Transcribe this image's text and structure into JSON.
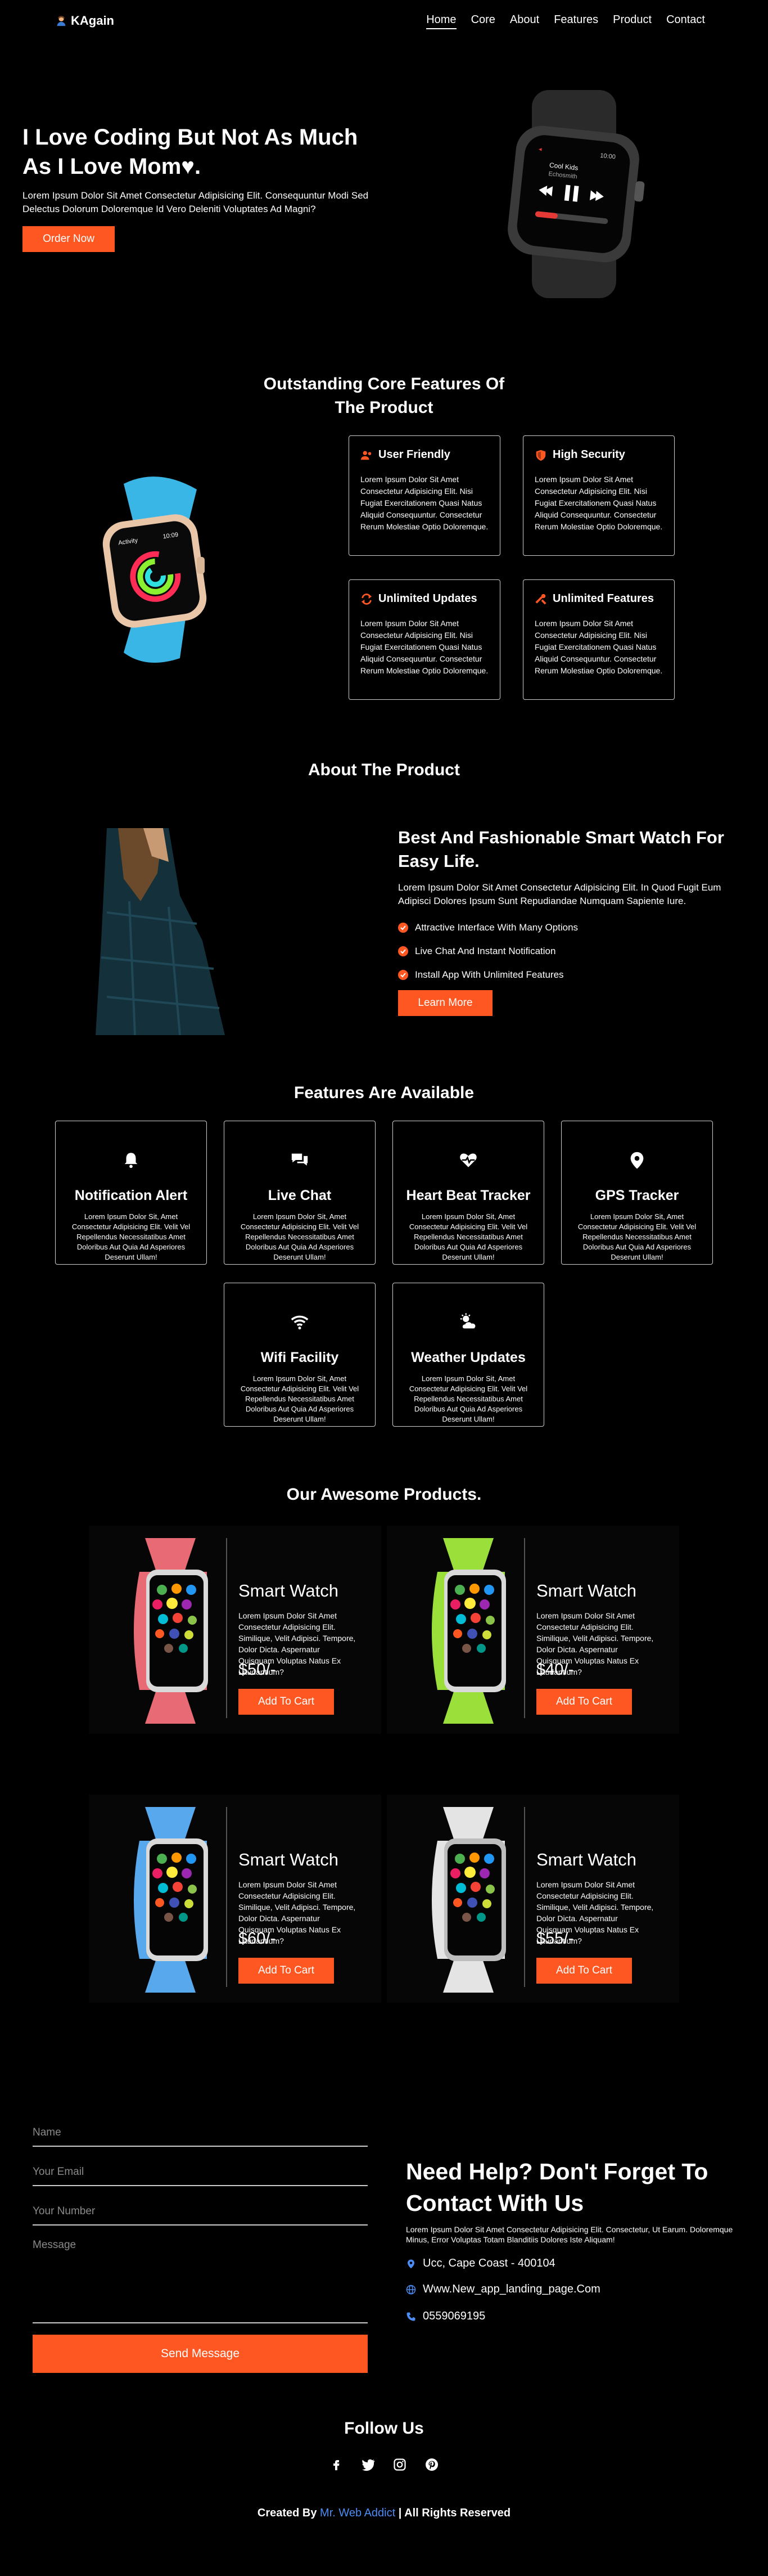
{
  "colors": {
    "accent": "#ff5722",
    "background": "#000000",
    "link": "#4c8cf5"
  },
  "nav": {
    "brand": "KAgain",
    "brand_icon": "person-icon",
    "links": [
      "Home",
      "Core",
      "About",
      "Features",
      "Product",
      "Contact"
    ],
    "active": "Home"
  },
  "hero": {
    "title_line1": "I Love Coding But Not As Much",
    "title_line2": "As I Love Mom",
    "heart": "♥",
    "period": ".",
    "subtitle": "Lorem Ipsum Dolor Sit Amet Consectetur Adipisicing Elit. Consequuntur Modi Sed Delectus Dolorum Doloremque Id Vero Deleniti Voluptates Ad Magni?",
    "button": "Order Now",
    "watch_screen": {
      "time": "10:00",
      "title": "Cool Kids",
      "artist": "Echosmith"
    }
  },
  "core": {
    "title_line1": "Outstanding Core Features Of",
    "title_line2": "The Product",
    "watch_screen": {
      "label": "Activity",
      "time": "10:09"
    },
    "cards": [
      {
        "title": "User Friendly",
        "icon": "users-icon",
        "text": "Lorem Ipsum Dolor Sit Amet Consectetur Adipisicing Elit. Nisi Fugiat Exercitationem Quasi Natus Aliquid Consequuntur. Consectetur Rerum Molestiae Optio Doloremque."
      },
      {
        "title": "High Security",
        "icon": "shield-icon",
        "text": "Lorem Ipsum Dolor Sit Amet Consectetur Adipisicing Elit. Nisi Fugiat Exercitationem Quasi Natus Aliquid Consequuntur. Consectetur Rerum Molestiae Optio Doloremque."
      },
      {
        "title": "Unlimited Updates",
        "icon": "sync-icon",
        "text": "Lorem Ipsum Dolor Sit Amet Consectetur Adipisicing Elit. Nisi Fugiat Exercitationem Quasi Natus Aliquid Consequuntur. Consectetur Rerum Molestiae Optio Doloremque."
      },
      {
        "title": "Unlimited Features",
        "icon": "tools-icon",
        "text": "Lorem Ipsum Dolor Sit Amet Consectetur Adipisicing Elit. Nisi Fugiat Exercitationem Quasi Natus Aliquid Consequuntur. Consectetur Rerum Molestiae Optio Doloremque."
      }
    ]
  },
  "about": {
    "title": "About The Product",
    "heading": "Best And Fashionable Smart Watch For Easy Life.",
    "text": "Lorem Ipsum Dolor Sit Amet Consectetur Adipisicing Elit. In Quod Fugit Eum Adipisci Dolores Ipsum Sunt Repudiandae Numquam Sapiente Iure.",
    "list": [
      "Attractive Interface With Many Options",
      "Live Chat And Instant Notification",
      "Install App With Unlimited Features"
    ],
    "button": "Learn More"
  },
  "features": {
    "title": "Features Are Available",
    "text": "Lorem Ipsum Dolor Sit, Amet Consectetur Adipisicing Elit. Velit Vel Repellendus Necessitatibus Amet Doloribus Aut Quia Ad Asperiores Deserunt Ullam!",
    "items": [
      {
        "title": "Notification Alert",
        "icon": "bell-icon"
      },
      {
        "title": "Live Chat",
        "icon": "chat-icon"
      },
      {
        "title": "Heart Beat Tracker",
        "icon": "heartbeat-icon"
      },
      {
        "title": "GPS Tracker",
        "icon": "location-icon"
      },
      {
        "title": "Wifi Facility",
        "icon": "wifi-icon"
      },
      {
        "title": "Weather Updates",
        "icon": "weather-icon"
      }
    ]
  },
  "products": {
    "title": "Our Awesome Products.",
    "items": [
      {
        "name": "Smart Watch",
        "price": "$50/-",
        "band": "#e86a74",
        "button": "Add To Cart",
        "text": "Lorem Ipsum Dolor Sit Amet Consectetur Adipisicing Elit. Similique, Velit Adipisci. Tempore, Dolor Dicta. Aspernatur Quisquam Voluptas Natus Ex Laudantium?"
      },
      {
        "name": "Smart Watch",
        "price": "$40/-",
        "band": "#9adf3a",
        "button": "Add To Cart",
        "text": "Lorem Ipsum Dolor Sit Amet Consectetur Adipisicing Elit. Similique, Velit Adipisci. Tempore, Dolor Dicta. Aspernatur Quisquam Voluptas Natus Ex Laudantium?"
      },
      {
        "name": "Smart Watch",
        "price": "$60/-",
        "band": "#58a8ee",
        "button": "Add To Cart",
        "text": "Lorem Ipsum Dolor Sit Amet Consectetur Adipisicing Elit. Similique, Velit Adipisci. Tempore, Dolor Dicta. Aspernatur Quisquam Voluptas Natus Ex Laudantium?"
      },
      {
        "name": "Smart Watch",
        "price": "$55/-",
        "band": "#e4e4e4",
        "button": "Add To Cart",
        "text": "Lorem Ipsum Dolor Sit Amet Consectetur Adipisicing Elit. Similique, Velit Adipisci. Tempore, Dolor Dicta. Aspernatur Quisquam Voluptas Natus Ex Laudantium?"
      }
    ]
  },
  "contact": {
    "name_placeholder": "Name",
    "email_placeholder": "Your Email",
    "number_placeholder": "Your Number",
    "message_placeholder": "Message",
    "send_button": "Send Message",
    "heading_line1": "Need Help? Don't Forget To",
    "heading_line2": "Contact With Us",
    "text": "Lorem Ipsum Dolor Sit Amet Consectetur Adipisicing Elit. Consectetur, Ut Earum. Doloremque Minus, Error Voluptas Totam Blanditiis Dolores Iste Aliquam!",
    "address": "Ucc, Cape Coast - 400104",
    "website": "Www.New_app_landing_page.Com",
    "phone": "0559069195"
  },
  "footer": {
    "follow": "Follow Us",
    "socials": [
      "facebook-icon",
      "twitter-icon",
      "instagram-icon",
      "pinterest-icon"
    ],
    "credit_prefix": "Created By",
    "credit_link": "Mr. Web Addict",
    "credit_suffix": "| All Rights Reserved"
  }
}
